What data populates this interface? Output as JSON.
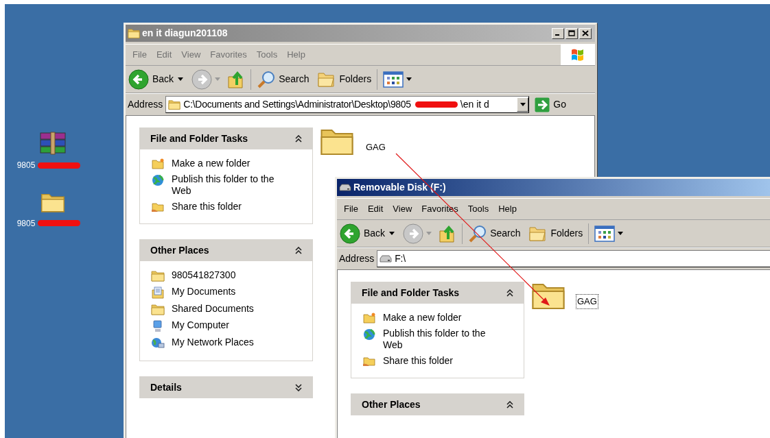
{
  "desktop_icons": [
    {
      "kind": "archive",
      "label": "9805"
    },
    {
      "kind": "folder",
      "label": "9805"
    }
  ],
  "windows": [
    {
      "title": "en it diagun201108",
      "active": false,
      "kind": "folder",
      "menu": [
        "File",
        "Edit",
        "View",
        "Favorites",
        "Tools",
        "Help"
      ],
      "toolbar": {
        "back": "Back",
        "search": "Search",
        "folders": "Folders"
      },
      "address": {
        "label": "Address",
        "value": "C:\\Documents and Settings\\Administrator\\Desktop\\9805",
        "value_after_mark": "\\en it d",
        "go": "Go"
      },
      "panels": [
        {
          "title": "File and Folder Tasks",
          "expanded": true,
          "items": [
            {
              "kind": "new-folder",
              "label": "Make a new folder"
            },
            {
              "kind": "globe",
              "label": "Publish this folder to the Web"
            },
            {
              "kind": "share",
              "label": "Share this folder"
            }
          ]
        },
        {
          "title": "Other Places",
          "expanded": true,
          "items": [
            {
              "kind": "folder",
              "label": "980541827300"
            },
            {
              "kind": "documents",
              "label": "My Documents"
            },
            {
              "kind": "folder",
              "label": "Shared Documents"
            },
            {
              "kind": "computer",
              "label": "My Computer"
            },
            {
              "kind": "network",
              "label": "My Network Places"
            }
          ]
        },
        {
          "title": "Details",
          "expanded": false
        }
      ],
      "files": [
        {
          "name": "GAG",
          "focused": false
        }
      ]
    },
    {
      "title": "Removable Disk (F:)",
      "active": true,
      "kind": "drive",
      "menu": [
        "File",
        "Edit",
        "View",
        "Favorites",
        "Tools",
        "Help"
      ],
      "toolbar": {
        "back": "Back",
        "search": "Search",
        "folders": "Folders"
      },
      "address": {
        "label": "Address",
        "value": "F:\\"
      },
      "panels": [
        {
          "title": "File and Folder Tasks",
          "expanded": true,
          "items": [
            {
              "kind": "new-folder",
              "label": "Make a new folder"
            },
            {
              "kind": "globe",
              "label": "Publish this folder to the Web"
            },
            {
              "kind": "share",
              "label": "Share this folder"
            }
          ]
        },
        {
          "title": "Other Places",
          "expanded": true
        }
      ],
      "files": [
        {
          "name": "GAG",
          "focused": true
        }
      ]
    }
  ]
}
